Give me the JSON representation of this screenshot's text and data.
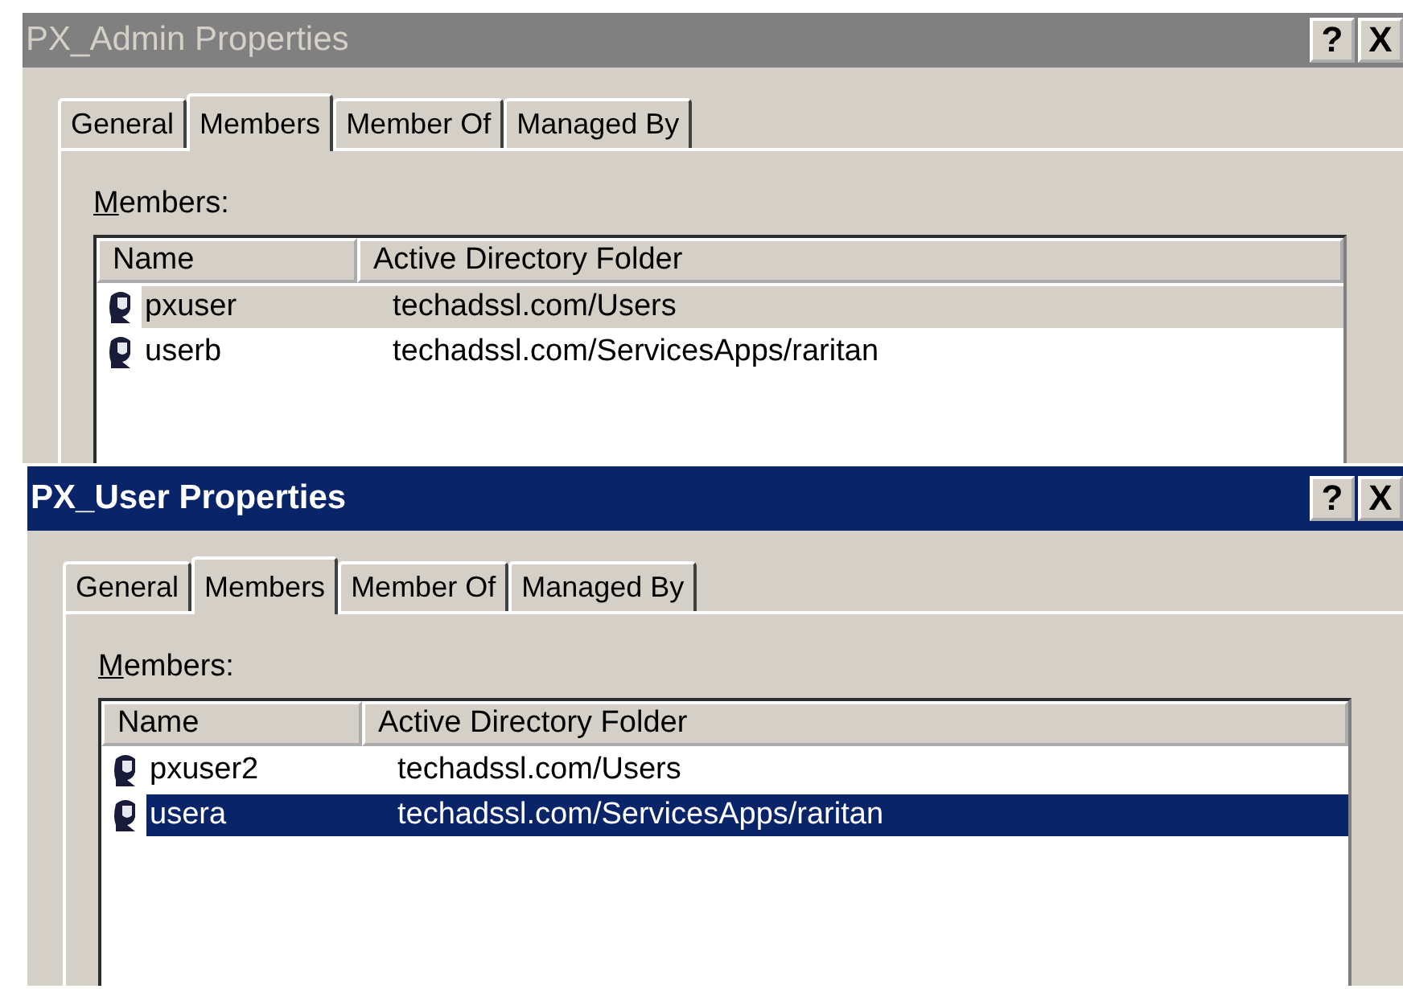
{
  "windows": [
    {
      "title": "PX_Admin Properties",
      "active": false,
      "title_buttons": [
        "?",
        "X"
      ],
      "tabs": [
        {
          "label": "General",
          "selected": false
        },
        {
          "label": "Members",
          "selected": true
        },
        {
          "label": "Member Of",
          "selected": false
        },
        {
          "label": "Managed By",
          "selected": false
        }
      ],
      "list_label": "Members:",
      "columns": [
        "Name",
        "Active Directory Folder"
      ],
      "rows": [
        {
          "name": "pxuser",
          "folder": "techadssl.com/Users",
          "selected": true
        },
        {
          "name": "userb",
          "folder": "techadssl.com/ServicesApps/raritan",
          "selected": false
        }
      ]
    },
    {
      "title": "PX_User Properties",
      "active": true,
      "title_buttons": [
        "?",
        "X"
      ],
      "tabs": [
        {
          "label": "General",
          "selected": false
        },
        {
          "label": "Members",
          "selected": true
        },
        {
          "label": "Member Of",
          "selected": false
        },
        {
          "label": "Managed By",
          "selected": false
        }
      ],
      "list_label": "Members:",
      "columns": [
        "Name",
        "Active Directory Folder"
      ],
      "rows": [
        {
          "name": "pxuser2",
          "folder": "techadssl.com/Users",
          "selected": false
        },
        {
          "name": "usera",
          "folder": "techadssl.com/ServicesApps/raritan",
          "selected": true
        }
      ]
    }
  ]
}
